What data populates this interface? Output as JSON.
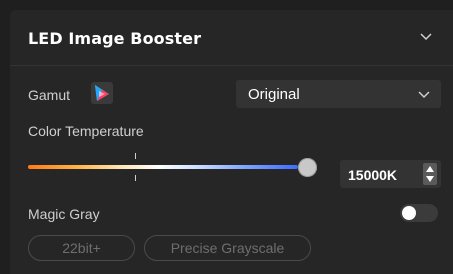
{
  "panel": {
    "title": "LED Image Booster",
    "collapse_icon": "chevron-down-icon"
  },
  "gamut": {
    "label": "Gamut",
    "icon": "color-gamut-icon",
    "selected": "Original",
    "dropdown_icon": "chevron-down-icon"
  },
  "color_temperature": {
    "label": "Color Temperature",
    "value": 15000,
    "value_display": "15000K",
    "stepper_icon": "up-down-arrows-icon",
    "gradient_colors": [
      "#ff7a18",
      "#ffffff",
      "#3d6cff"
    ]
  },
  "magic_gray": {
    "label": "Magic Gray",
    "enabled": false
  },
  "options": [
    {
      "label": "22bit+"
    },
    {
      "label": "Precise Grayscale"
    }
  ],
  "colors": {
    "background": "#1f1f1f",
    "panel": "#262626",
    "control": "#333333",
    "text": "#ffffff"
  }
}
